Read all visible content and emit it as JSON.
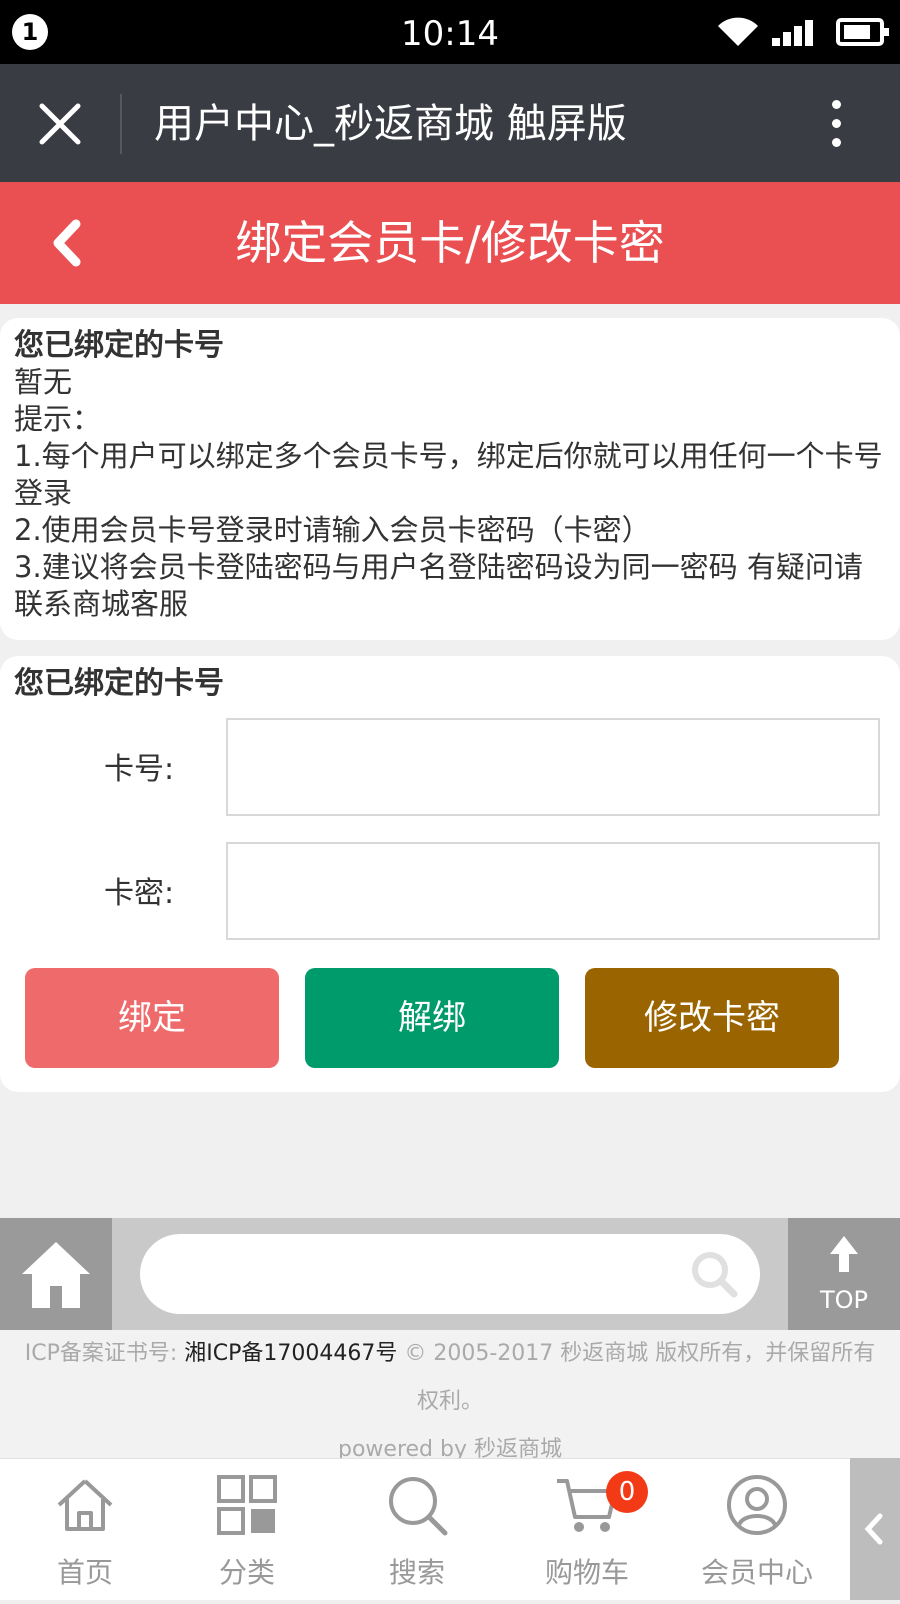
{
  "status_bar": {
    "notification_count": "1",
    "time": "10:14"
  },
  "browser": {
    "title": "用户中心_秒返商城 触屏版",
    "close_icon": "close-icon",
    "more_icon": "more-vertical-icon"
  },
  "header": {
    "title": "绑定会员卡/修改卡密",
    "back_icon": "chevron-left-icon"
  },
  "bound_cards": {
    "heading": "您已绑定的卡号",
    "value": "暂无",
    "tips_title": "提示：",
    "tips": [
      "1.每个用户可以绑定多个会员卡号，绑定后你就可以用任何一个卡号登录",
      "2.使用会员卡号登录时请输入会员卡密码（卡密）",
      "3.建议将会员卡登陆密码与用户名登陆密码设为同一密码 有疑问请联系商城客服"
    ]
  },
  "form": {
    "heading": "您已绑定的卡号",
    "card_number_label": "卡号:",
    "card_number_value": "",
    "card_password_label": "卡密:",
    "card_password_value": "",
    "bind_label": "绑定",
    "unbind_label": "解绑",
    "change_password_label": "修改卡密",
    "colors": {
      "bind": "#ef6b6b",
      "unbind": "#009b6a",
      "change": "#9a6501"
    }
  },
  "search": {
    "placeholder": "",
    "top_label": "TOP"
  },
  "footer": {
    "icp_prefix": "ICP备案证书号:",
    "icp_number": "湘ICP备17004467号",
    "copyright": "© 2005-2017 秒返商城 版权所有，并保留所有权利。",
    "powered": "powered by 秒返商城"
  },
  "tabbar": {
    "items": [
      {
        "label": "首页",
        "icon": "home-icon"
      },
      {
        "label": "分类",
        "icon": "grid-icon"
      },
      {
        "label": "搜索",
        "icon": "search-icon"
      },
      {
        "label": "购物车",
        "icon": "cart-icon",
        "badge": "0"
      },
      {
        "label": "会员中心",
        "icon": "user-icon"
      }
    ]
  },
  "accent_color": "#ea5052"
}
